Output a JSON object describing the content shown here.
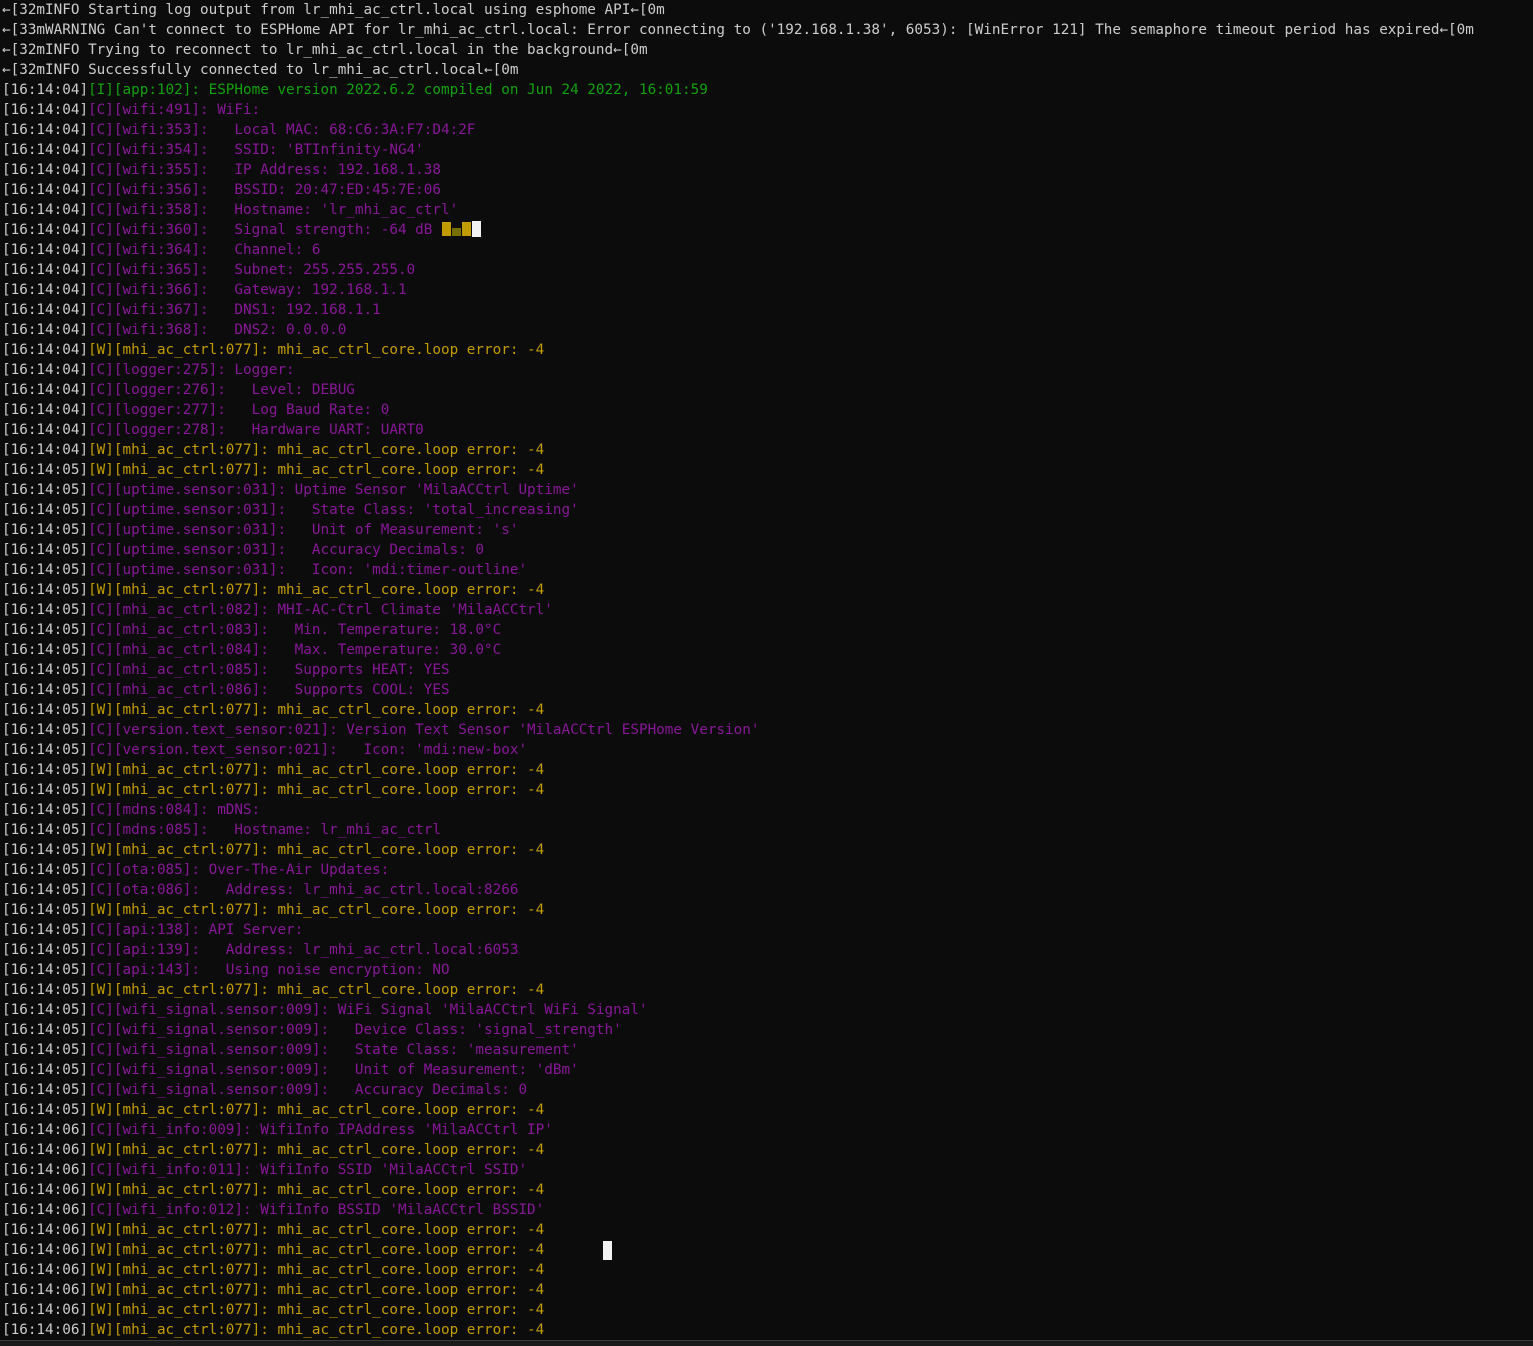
{
  "colors": {
    "background": "#0c0c0c",
    "default_text": "#cccccc",
    "info": "#13a10e",
    "config": "#881798",
    "warning": "#c19c00",
    "cursor": "#f2f2f2"
  },
  "lines": [
    {
      "ts": "",
      "level": "raw",
      "text": "←[32mINFO Starting log output from lr_mhi_ac_ctrl.local using esphome API←[0m"
    },
    {
      "ts": "",
      "level": "raw",
      "text": "←[33mWARNING Can't connect to ESPHome API for lr_mhi_ac_ctrl.local: Error connecting to ('192.168.1.38', 6053): [WinError 121] The semaphore timeout period has expired←[0m"
    },
    {
      "ts": "",
      "level": "raw",
      "text": "←[32mINFO Trying to reconnect to lr_mhi_ac_ctrl.local in the background←[0m"
    },
    {
      "ts": "",
      "level": "raw",
      "text": "←[32mINFO Successfully connected to lr_mhi_ac_ctrl.local←[0m"
    },
    {
      "ts": "[16:14:04]",
      "level": "I",
      "text": "[I][app:102]: ESPHome version 2022.6.2 compiled on Jun 24 2022, 16:01:59"
    },
    {
      "ts": "[16:14:04]",
      "level": "C",
      "text": "[C][wifi:491]: WiFi:"
    },
    {
      "ts": "[16:14:04]",
      "level": "C",
      "text": "[C][wifi:353]:   Local MAC: 68:C6:3A:F7:D4:2F"
    },
    {
      "ts": "[16:14:04]",
      "level": "C",
      "text": "[C][wifi:354]:   SSID: 'BTInfinity-NG4'"
    },
    {
      "ts": "[16:14:04]",
      "level": "C",
      "text": "[C][wifi:355]:   IP Address: 192.168.1.38"
    },
    {
      "ts": "[16:14:04]",
      "level": "C",
      "text": "[C][wifi:356]:   BSSID: 20:47:ED:45:7E:06"
    },
    {
      "ts": "[16:14:04]",
      "level": "C",
      "text": "[C][wifi:358]:   Hostname: 'lr_mhi_ac_ctrl'"
    },
    {
      "ts": "[16:14:04]",
      "level": "C",
      "text": "[C][wifi:360]:   Signal strength: -64 dB ",
      "signal_glyph": true
    },
    {
      "ts": "[16:14:04]",
      "level": "C",
      "text": "[C][wifi:364]:   Channel: 6"
    },
    {
      "ts": "[16:14:04]",
      "level": "C",
      "text": "[C][wifi:365]:   Subnet: 255.255.255.0"
    },
    {
      "ts": "[16:14:04]",
      "level": "C",
      "text": "[C][wifi:366]:   Gateway: 192.168.1.1"
    },
    {
      "ts": "[16:14:04]",
      "level": "C",
      "text": "[C][wifi:367]:   DNS1: 192.168.1.1"
    },
    {
      "ts": "[16:14:04]",
      "level": "C",
      "text": "[C][wifi:368]:   DNS2: 0.0.0.0"
    },
    {
      "ts": "[16:14:04]",
      "level": "W",
      "text": "[W][mhi_ac_ctrl:077]: mhi_ac_ctrl_core.loop error: -4"
    },
    {
      "ts": "[16:14:04]",
      "level": "C",
      "text": "[C][logger:275]: Logger:"
    },
    {
      "ts": "[16:14:04]",
      "level": "C",
      "text": "[C][logger:276]:   Level: DEBUG"
    },
    {
      "ts": "[16:14:04]",
      "level": "C",
      "text": "[C][logger:277]:   Log Baud Rate: 0"
    },
    {
      "ts": "[16:14:04]",
      "level": "C",
      "text": "[C][logger:278]:   Hardware UART: UART0"
    },
    {
      "ts": "[16:14:04]",
      "level": "W",
      "text": "[W][mhi_ac_ctrl:077]: mhi_ac_ctrl_core.loop error: -4"
    },
    {
      "ts": "[16:14:05]",
      "level": "W",
      "text": "[W][mhi_ac_ctrl:077]: mhi_ac_ctrl_core.loop error: -4"
    },
    {
      "ts": "[16:14:05]",
      "level": "C",
      "text": "[C][uptime.sensor:031]: Uptime Sensor 'MilaACCtrl Uptime'"
    },
    {
      "ts": "[16:14:05]",
      "level": "C",
      "text": "[C][uptime.sensor:031]:   State Class: 'total_increasing'"
    },
    {
      "ts": "[16:14:05]",
      "level": "C",
      "text": "[C][uptime.sensor:031]:   Unit of Measurement: 's'"
    },
    {
      "ts": "[16:14:05]",
      "level": "C",
      "text": "[C][uptime.sensor:031]:   Accuracy Decimals: 0"
    },
    {
      "ts": "[16:14:05]",
      "level": "C",
      "text": "[C][uptime.sensor:031]:   Icon: 'mdi:timer-outline'"
    },
    {
      "ts": "[16:14:05]",
      "level": "W",
      "text": "[W][mhi_ac_ctrl:077]: mhi_ac_ctrl_core.loop error: -4"
    },
    {
      "ts": "[16:14:05]",
      "level": "C",
      "text": "[C][mhi_ac_ctrl:082]: MHI-AC-Ctrl Climate 'MilaACCtrl'"
    },
    {
      "ts": "[16:14:05]",
      "level": "C",
      "text": "[C][mhi_ac_ctrl:083]:   Min. Temperature: 18.0°C"
    },
    {
      "ts": "[16:14:05]",
      "level": "C",
      "text": "[C][mhi_ac_ctrl:084]:   Max. Temperature: 30.0°C"
    },
    {
      "ts": "[16:14:05]",
      "level": "C",
      "text": "[C][mhi_ac_ctrl:085]:   Supports HEAT: YES"
    },
    {
      "ts": "[16:14:05]",
      "level": "C",
      "text": "[C][mhi_ac_ctrl:086]:   Supports COOL: YES"
    },
    {
      "ts": "[16:14:05]",
      "level": "W",
      "text": "[W][mhi_ac_ctrl:077]: mhi_ac_ctrl_core.loop error: -4"
    },
    {
      "ts": "[16:14:05]",
      "level": "C",
      "text": "[C][version.text_sensor:021]: Version Text Sensor 'MilaACCtrl ESPHome Version'"
    },
    {
      "ts": "[16:14:05]",
      "level": "C",
      "text": "[C][version.text_sensor:021]:   Icon: 'mdi:new-box'"
    },
    {
      "ts": "[16:14:05]",
      "level": "W",
      "text": "[W][mhi_ac_ctrl:077]: mhi_ac_ctrl_core.loop error: -4"
    },
    {
      "ts": "[16:14:05]",
      "level": "W",
      "text": "[W][mhi_ac_ctrl:077]: mhi_ac_ctrl_core.loop error: -4"
    },
    {
      "ts": "[16:14:05]",
      "level": "C",
      "text": "[C][mdns:084]: mDNS:"
    },
    {
      "ts": "[16:14:05]",
      "level": "C",
      "text": "[C][mdns:085]:   Hostname: lr_mhi_ac_ctrl"
    },
    {
      "ts": "[16:14:05]",
      "level": "W",
      "text": "[W][mhi_ac_ctrl:077]: mhi_ac_ctrl_core.loop error: -4"
    },
    {
      "ts": "[16:14:05]",
      "level": "C",
      "text": "[C][ota:085]: Over-The-Air Updates:"
    },
    {
      "ts": "[16:14:05]",
      "level": "C",
      "text": "[C][ota:086]:   Address: lr_mhi_ac_ctrl.local:8266"
    },
    {
      "ts": "[16:14:05]",
      "level": "W",
      "text": "[W][mhi_ac_ctrl:077]: mhi_ac_ctrl_core.loop error: -4"
    },
    {
      "ts": "[16:14:05]",
      "level": "C",
      "text": "[C][api:138]: API Server:"
    },
    {
      "ts": "[16:14:05]",
      "level": "C",
      "text": "[C][api:139]:   Address: lr_mhi_ac_ctrl.local:6053"
    },
    {
      "ts": "[16:14:05]",
      "level": "C",
      "text": "[C][api:143]:   Using noise encryption: NO"
    },
    {
      "ts": "[16:14:05]",
      "level": "W",
      "text": "[W][mhi_ac_ctrl:077]: mhi_ac_ctrl_core.loop error: -4"
    },
    {
      "ts": "[16:14:05]",
      "level": "C",
      "text": "[C][wifi_signal.sensor:009]: WiFi Signal 'MilaACCtrl WiFi Signal'"
    },
    {
      "ts": "[16:14:05]",
      "level": "C",
      "text": "[C][wifi_signal.sensor:009]:   Device Class: 'signal_strength'"
    },
    {
      "ts": "[16:14:05]",
      "level": "C",
      "text": "[C][wifi_signal.sensor:009]:   State Class: 'measurement'"
    },
    {
      "ts": "[16:14:05]",
      "level": "C",
      "text": "[C][wifi_signal.sensor:009]:   Unit of Measurement: 'dBm'"
    },
    {
      "ts": "[16:14:05]",
      "level": "C",
      "text": "[C][wifi_signal.sensor:009]:   Accuracy Decimals: 0"
    },
    {
      "ts": "[16:14:05]",
      "level": "W",
      "text": "[W][mhi_ac_ctrl:077]: mhi_ac_ctrl_core.loop error: -4"
    },
    {
      "ts": "[16:14:06]",
      "level": "C",
      "text": "[C][wifi_info:009]: WifiInfo IPAddress 'MilaACCtrl IP'"
    },
    {
      "ts": "[16:14:06]",
      "level": "W",
      "text": "[W][mhi_ac_ctrl:077]: mhi_ac_ctrl_core.loop error: -4"
    },
    {
      "ts": "[16:14:06]",
      "level": "C",
      "text": "[C][wifi_info:011]: WifiInfo SSID 'MilaACCtrl SSID'"
    },
    {
      "ts": "[16:14:06]",
      "level": "W",
      "text": "[W][mhi_ac_ctrl:077]: mhi_ac_ctrl_core.loop error: -4"
    },
    {
      "ts": "[16:14:06]",
      "level": "C",
      "text": "[C][wifi_info:012]: WifiInfo BSSID 'MilaACCtrl BSSID'"
    },
    {
      "ts": "[16:14:06]",
      "level": "W",
      "text": "[W][mhi_ac_ctrl:077]: mhi_ac_ctrl_core.loop error: -4"
    },
    {
      "ts": "[16:14:06]",
      "level": "W",
      "text": "[W][mhi_ac_ctrl:077]: mhi_ac_ctrl_core.loop error: -4"
    },
    {
      "ts": "[16:14:06]",
      "level": "W",
      "text": "[W][mhi_ac_ctrl:077]: mhi_ac_ctrl_core.loop error: -4"
    },
    {
      "ts": "[16:14:06]",
      "level": "W",
      "text": "[W][mhi_ac_ctrl:077]: mhi_ac_ctrl_core.loop error: -4"
    },
    {
      "ts": "[16:14:06]",
      "level": "W",
      "text": "[W][mhi_ac_ctrl:077]: mhi_ac_ctrl_core.loop error: -4"
    },
    {
      "ts": "[16:14:06]",
      "level": "W",
      "text": "[W][mhi_ac_ctrl:077]: mhi_ac_ctrl_core.loop error: -4"
    }
  ]
}
